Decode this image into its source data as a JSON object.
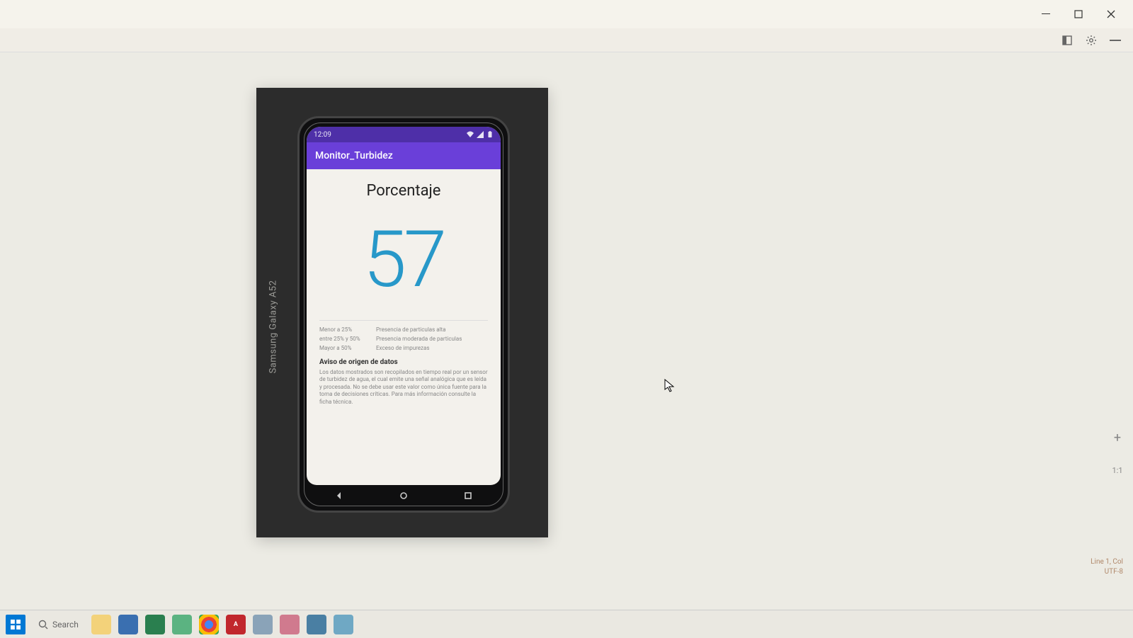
{
  "window": {
    "minimize": "—",
    "maximize": "▢",
    "close": "✕"
  },
  "device": {
    "label": "Samsung Galaxy A52"
  },
  "status": {
    "time": "12:09"
  },
  "app": {
    "title": "Monitor_Turbidez"
  },
  "main": {
    "heading": "Porcentaje",
    "value": "57"
  },
  "legend": {
    "rows": [
      {
        "l": "Menor a 25%",
        "r": "Presencia de particulas alta"
      },
      {
        "l": "entre 25% y 50%",
        "r": "Presencia moderada de particulas"
      },
      {
        "l": "Mayor a 50%",
        "r": "Exceso de impurezas"
      }
    ]
  },
  "notice": {
    "title": "Aviso de origen de datos",
    "body": "Los datos mostrados son recopilados en tiempo real por un sensor de turbidez de agua, el cual emite una señal analógica que es leída y procesada. No se debe usar este valor como única fuente para la toma de decisiones críticas. Para más información consulte la ficha técnica."
  },
  "zoom": {
    "plus": "+",
    "fit": "1:1"
  },
  "ide": {
    "line1": "Line 1, Col",
    "line2": "UTF-8"
  },
  "taskbar": {
    "search": "Search"
  }
}
